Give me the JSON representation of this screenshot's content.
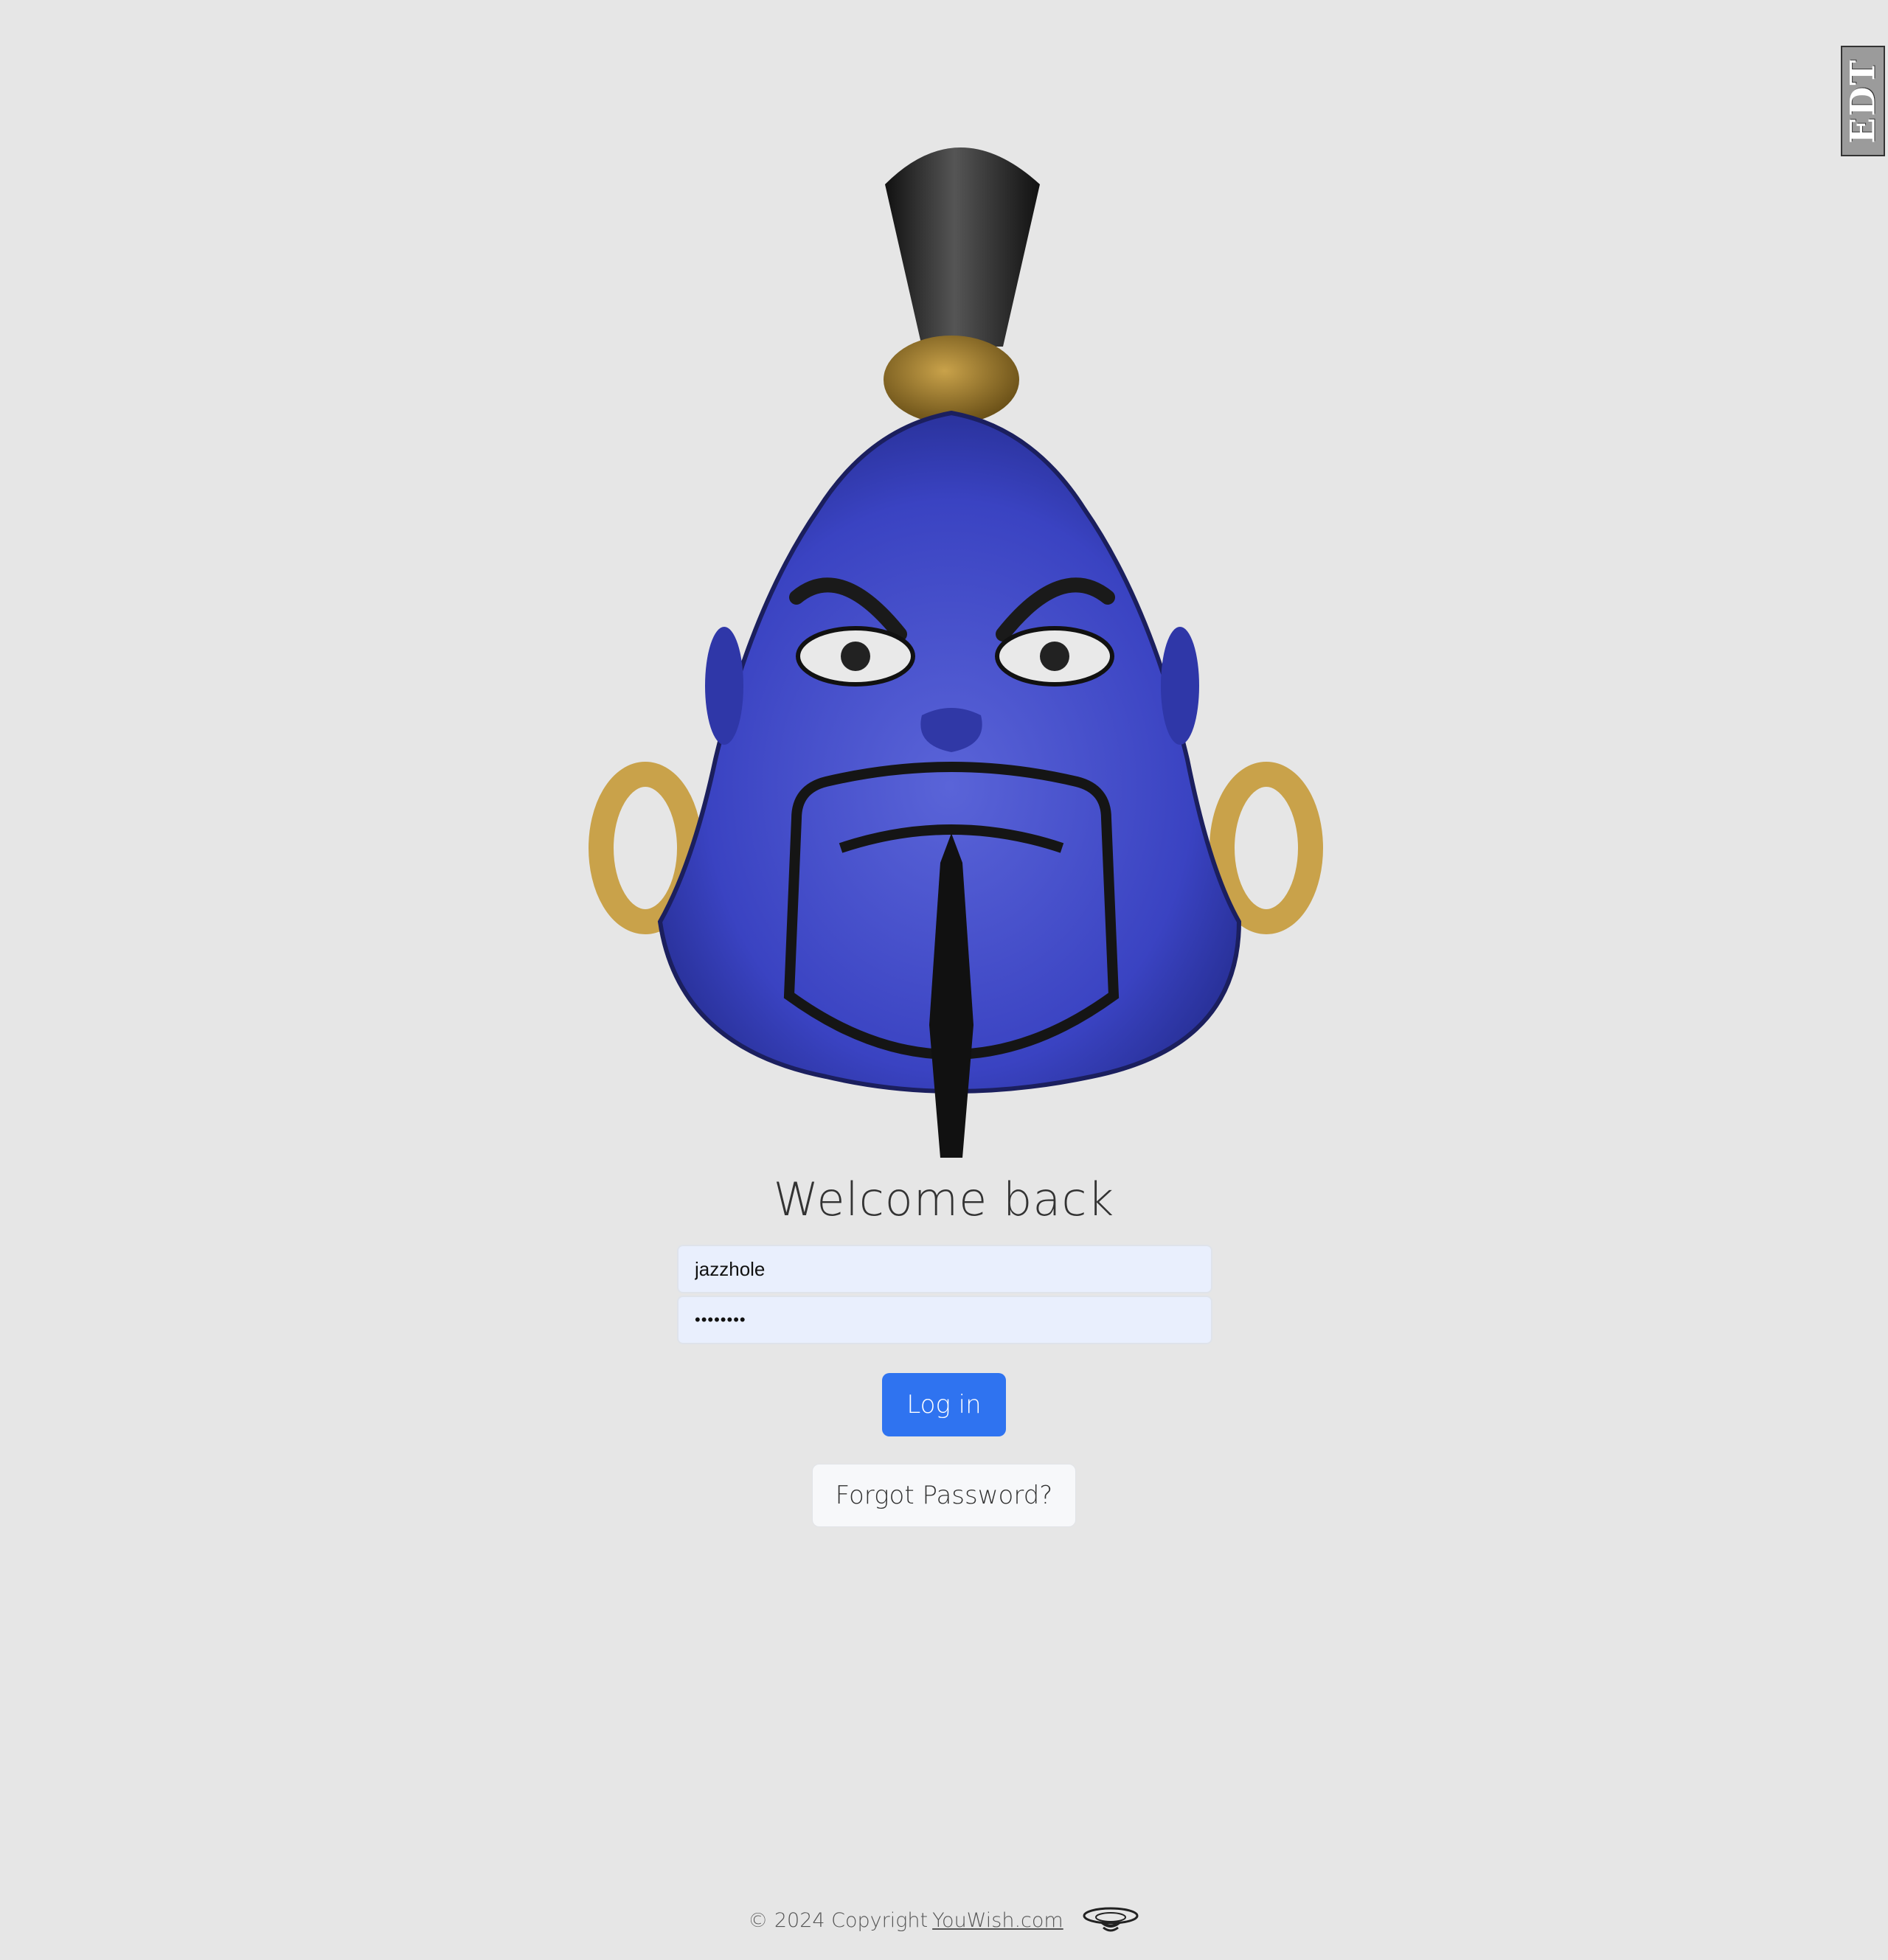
{
  "badge": {
    "text": "EDT"
  },
  "mascot": {
    "name": "genie-head-logo",
    "skin_color": "#3d45c4",
    "accent_gold": "#c9a24a"
  },
  "login": {
    "heading": "Welcome back",
    "username_value": "jazzhole",
    "password_value": "••••••••",
    "login_label": "Log in",
    "forgot_label": "Forgot Password?"
  },
  "footer": {
    "copyright": "© 2024 Copyright",
    "link_text": "YouWish.com",
    "icon": "lamp-icon"
  },
  "colors": {
    "background": "#e6e6e6",
    "primary_button": "#2f73f0",
    "input_bg": "#e9effd"
  }
}
